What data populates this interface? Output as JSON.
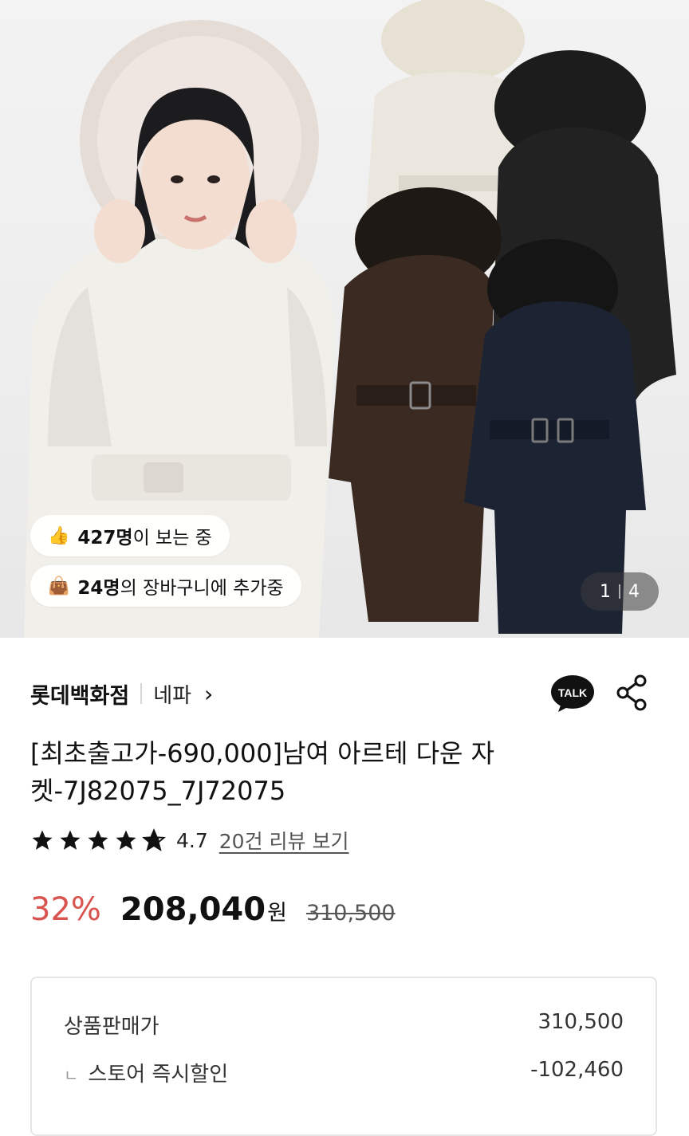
{
  "hero": {
    "viewers_count": "427명",
    "viewers_suffix": "이 보는 중",
    "viewers_icon": "thumbs-up-icon",
    "cart_count": "24명",
    "cart_suffix": "의 장바구니에 추가중",
    "cart_icon": "shopping-bag-icon",
    "image_index": "1",
    "image_total": "4"
  },
  "store": {
    "name": "롯데백화점",
    "brand": "네파",
    "talk_label": "TALK"
  },
  "product": {
    "title": "[최초출고가-690,000]남여 아르테 다운 자켓-7J82075_7J72075",
    "rating": "4.7",
    "review_link": "20건 리뷰 보기",
    "rating_value": 4.7
  },
  "price": {
    "discount": "32%",
    "sale_price": "208,040",
    "currency": "원",
    "original_price": "310,500"
  },
  "breakdown": {
    "row1_label": "상품판매가",
    "row1_value": "310,500",
    "row2_prefix": "ㄴ",
    "row2_label": "스토어 즉시할인",
    "row2_value": "-102,460"
  },
  "colors": {
    "discount": "#d9534f",
    "talk_bg": "#111111"
  }
}
